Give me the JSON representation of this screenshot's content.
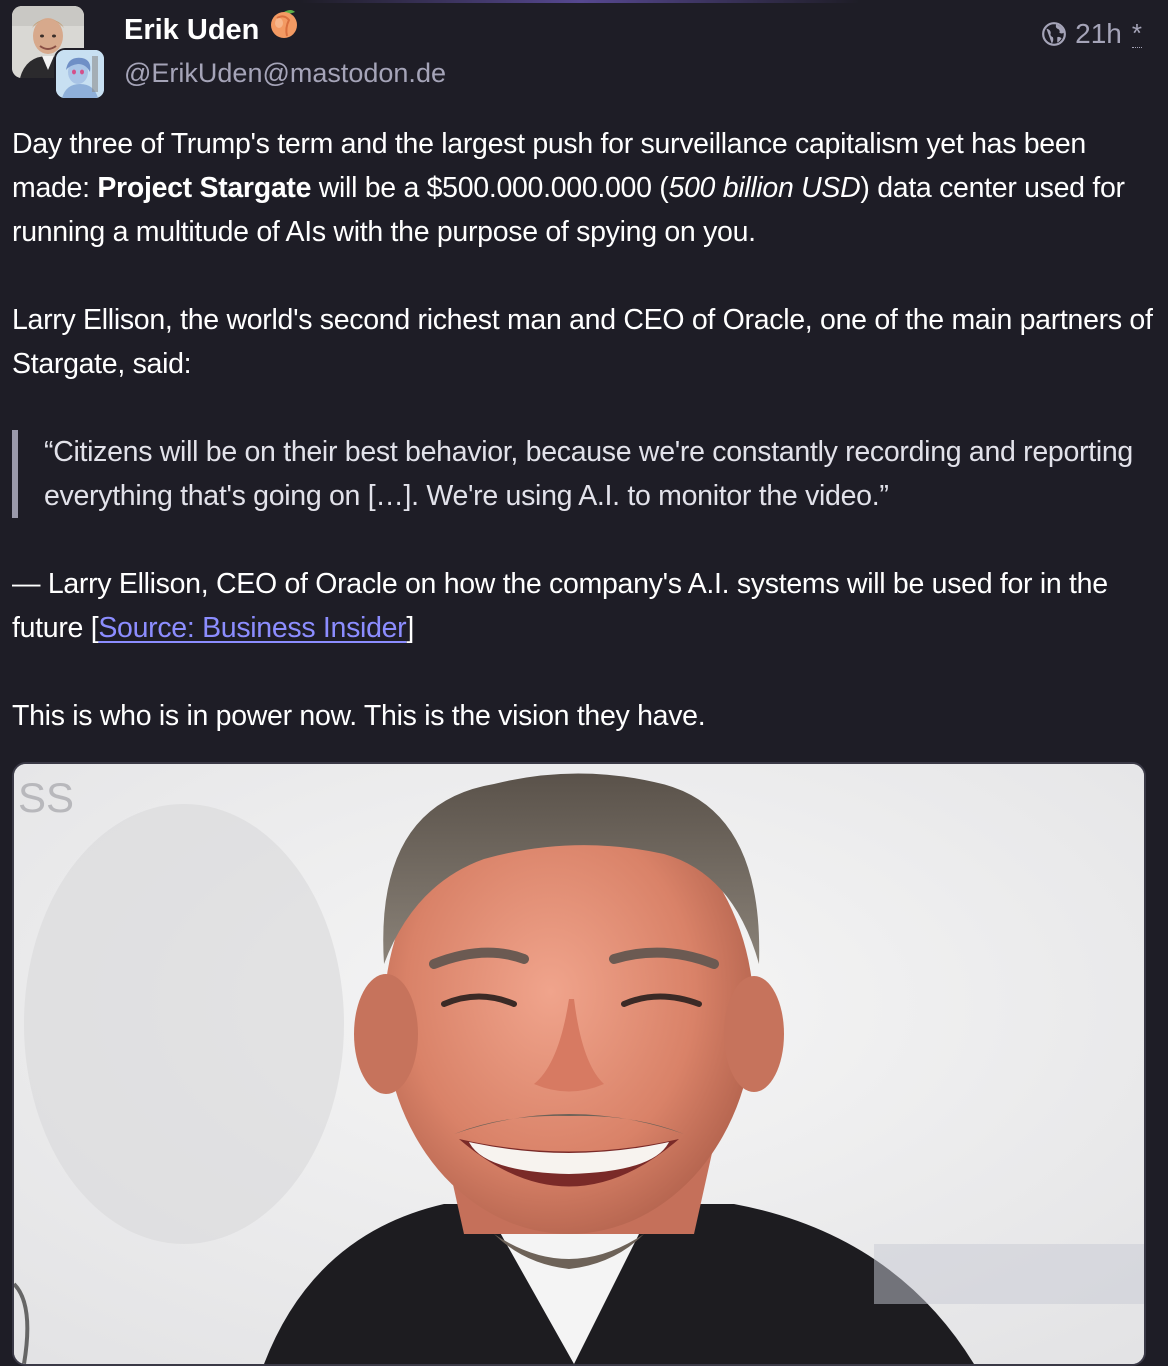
{
  "status": {
    "author": {
      "display_name": "Erik Uden",
      "emoji": "peach",
      "account": "@ErikUden@mastodon.de"
    },
    "meta": {
      "visibility_icon": "globe-icon",
      "time": "21h",
      "edited_mark": "*"
    },
    "content": {
      "p1_a": "Day three of Trump's term and the largest push for surveillance capitalism yet has been made: ",
      "p1_bold": "Project Stargate",
      "p1_b": " will be a $500.000.000.000 (",
      "p1_italic": "500 billion USD",
      "p1_c": ") data center used for running a multitude of AIs with the purpose of spying on you.",
      "p2": "Larry Ellison, the world's second richest man and CEO of Oracle, one of the main partners of Stargate, said:",
      "quote": "“Citizens will be on their best behavior, because we're constantly recording and reporting everything that's going on […]. We're using A.I. to monitor the video.”",
      "p3_a": "— Larry Ellison, CEO of Oracle on how the company's A.I. systems will be used for in the future [",
      "p3_link": "Source: Business Insider",
      "p3_b": "]",
      "p4": "This is who is in power now. This is the vision they have."
    },
    "media": {
      "icon": "photo-of-smiling-man",
      "corner_text": "SS"
    }
  }
}
